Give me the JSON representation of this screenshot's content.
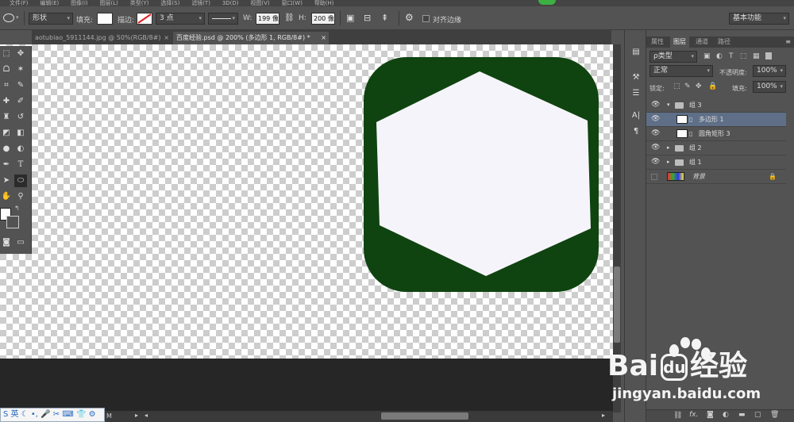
{
  "menu": [
    "文件(F)",
    "编辑(E)",
    "图像(I)",
    "图层(L)",
    "类型(Y)",
    "选择(S)",
    "滤镜(T)",
    "3D(D)",
    "视图(V)",
    "窗口(W)",
    "帮助(H)"
  ],
  "options": {
    "shape_mode": "形状",
    "fill_label": "填充:",
    "stroke_label": "描边:",
    "stroke_width": "3 点",
    "w_label": "W:",
    "w_value": "199 像",
    "h_label": "H:",
    "h_value": "200 像",
    "align_edges": "对齐边缘",
    "workspace": "基本功能"
  },
  "tabs": [
    {
      "label": "aotubiao_5911144.jpg @ 50%(RGB/8#)",
      "close": "×"
    },
    {
      "label": "百度经验.psd @ 200% (多边形 1, RGB/8#) *",
      "close": "×"
    }
  ],
  "layers_panel": {
    "tabs": [
      "属性",
      "图层",
      "通道",
      "路径"
    ],
    "filter": "ρ类型",
    "blend_mode": "正常",
    "opacity_label": "不透明度:",
    "opacity_value": "100%",
    "lock_label": "锁定:",
    "fill_label": "填充:",
    "fill_value": "100%",
    "layers": [
      {
        "name": "组 3",
        "type": "group",
        "expanded": true,
        "selected": false
      },
      {
        "name": "多边形 1",
        "type": "shape",
        "selected": true
      },
      {
        "name": "圆角矩形 3",
        "type": "shape",
        "selected": false
      },
      {
        "name": "组 2",
        "type": "group",
        "expanded": false,
        "selected": false
      },
      {
        "name": "组 1",
        "type": "group",
        "expanded": false,
        "selected": false
      },
      {
        "name": "背景",
        "type": "background",
        "selected": false
      }
    ]
  },
  "status": {
    "zoom_fragment": "M"
  },
  "ime_bar": {
    "text": "英"
  },
  "watermark": {
    "brand_left": "Bai",
    "brand_right": "经验",
    "url": "jingyan.baidu.com"
  },
  "colors": {
    "rounded_rect": "#0f4410",
    "hexagon": "#f6f4fb",
    "selected_layer": "#5f6f87"
  }
}
